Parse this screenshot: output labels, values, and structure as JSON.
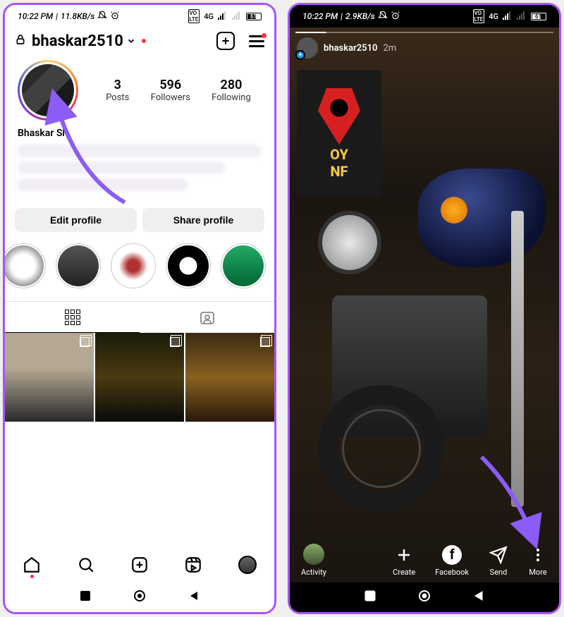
{
  "left": {
    "status": {
      "time": "10:22 PM",
      "net_speed": "11.8KB/s",
      "network_label": "4G",
      "battery": "61"
    },
    "header": {
      "username": "bhaskar2510",
      "has_new_story": true
    },
    "stats": {
      "posts": {
        "count": "3",
        "label": "Posts"
      },
      "followers": {
        "count": "596",
        "label": "Followers"
      },
      "following": {
        "count": "280",
        "label": "Following"
      }
    },
    "display_name": "Bhaskar Sh",
    "actions": {
      "edit": "Edit profile",
      "share": "Share profile"
    }
  },
  "right": {
    "status": {
      "time": "10:22 PM",
      "net_speed": "2.9KB/s",
      "network_label": "4G",
      "battery": "61"
    },
    "story": {
      "author": "bhaskar2510",
      "age": "2m",
      "sign_line1": "OY",
      "sign_line2": "NF"
    },
    "actions": {
      "activity": "Activity",
      "create": "Create",
      "facebook": "Facebook",
      "send": "Send",
      "more": "More"
    }
  }
}
